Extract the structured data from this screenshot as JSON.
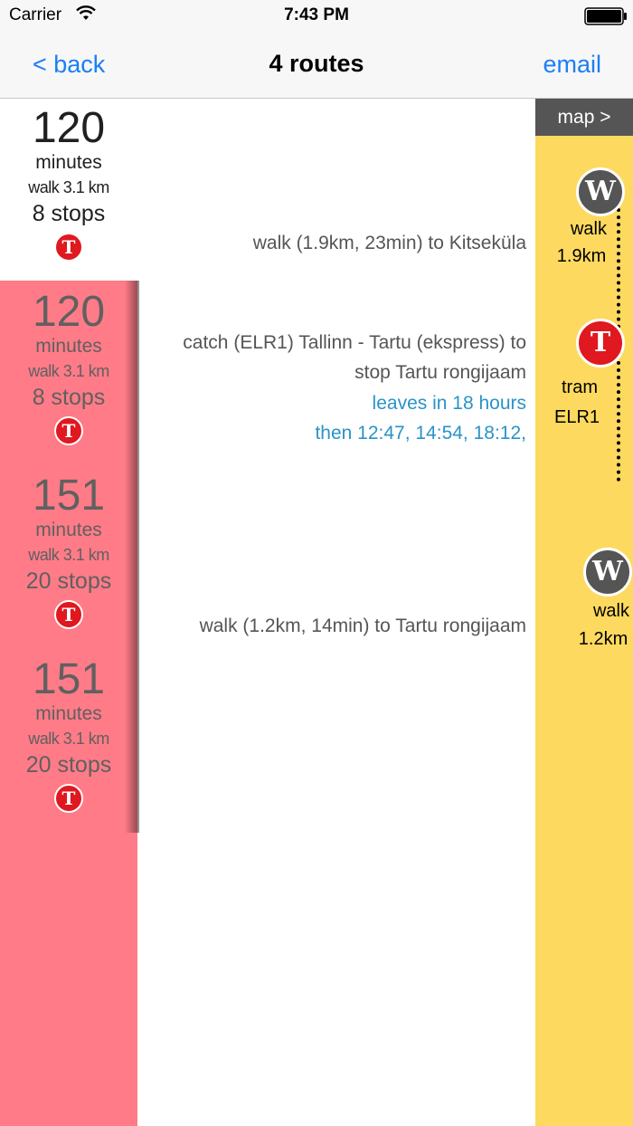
{
  "status_bar": {
    "carrier": "Carrier",
    "time": "7:43 PM"
  },
  "nav": {
    "back_label": "< back",
    "title": "4 routes",
    "email_label": "email"
  },
  "routes": [
    {
      "minutes": "120",
      "minutes_label": "minutes",
      "walk": "walk 3.1 km",
      "stops": "8 stops",
      "badge": "T"
    },
    {
      "minutes": "120",
      "minutes_label": "minutes",
      "walk": "walk 3.1 km",
      "stops": "8 stops",
      "badge": "T"
    },
    {
      "minutes": "151",
      "minutes_label": "minutes",
      "walk": "walk 3.1 km",
      "stops": "20 stops",
      "badge": "T"
    },
    {
      "minutes": "151",
      "minutes_label": "minutes",
      "walk": "walk 3.1 km",
      "stops": "20 stops",
      "badge": "T"
    }
  ],
  "steps": {
    "walk1": "walk (1.9km, 23min) to Kitseküla",
    "catch_line1": "catch (ELR1) Tallinn - Tartu (ekspress)  to",
    "catch_line2": "stop Tartu rongijaam",
    "leaves": "leaves in 18 hours",
    "then": "then 12:47, 14:54, 18:12,",
    "walk2": "walk (1.2km, 14min) to Tartu rongijaam"
  },
  "timeline": {
    "map_label": "map >",
    "nodes": [
      {
        "letter": "W",
        "label1": "walk",
        "label2": "1.9km"
      },
      {
        "letter": "T",
        "label1": "tram",
        "label2": "ELR1"
      },
      {
        "letter": "W",
        "label1": "walk",
        "label2": "1.2km"
      }
    ]
  },
  "colors": {
    "accent": "#1a7ff5",
    "route_list_bg": "#ff7b87",
    "timeline_bg": "#fdd95f",
    "tram_red": "#e0181f",
    "walk_grey": "#555555",
    "departure_blue": "#2a93c7"
  }
}
